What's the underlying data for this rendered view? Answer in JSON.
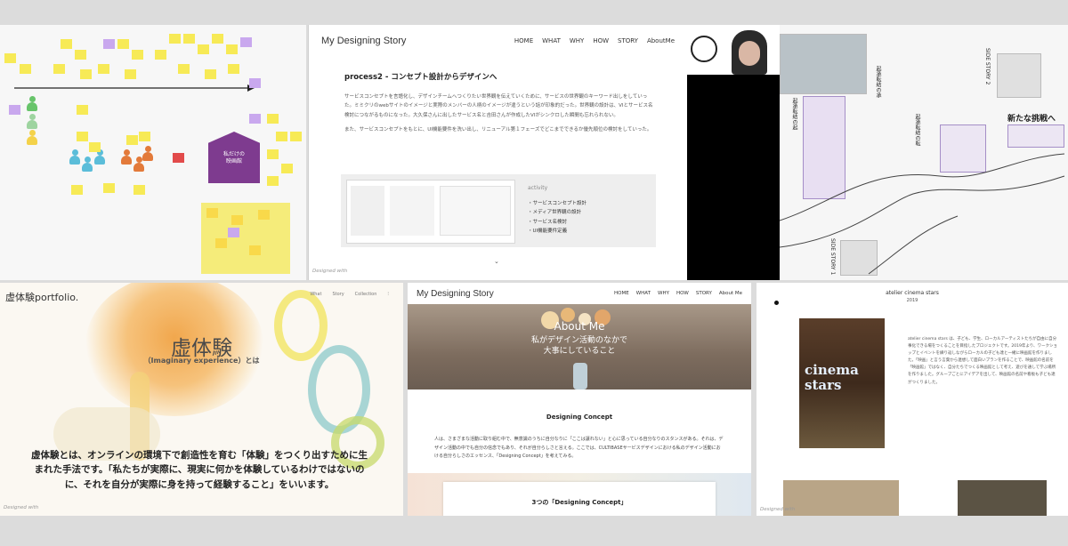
{
  "panel1": {
    "house_label_line1": "私だけの",
    "house_label_line2": "映画館"
  },
  "panel2": {
    "site_title": "My Designing Story",
    "nav": [
      "HOME",
      "WHAT",
      "WHY",
      "HOW",
      "STORY",
      "AboutMe"
    ],
    "section_title": "process2 - コンセプト設計からデザインへ",
    "para1": "サービスコンセプトを言語化し、デザインチームへつくりたい世界観を伝えていくために、サービスの世界観のキーワード出しをしていった。ミミクリのwebサイトのイメージと実際のメンバーの人柄のイメージが違うという話が印象的だった。世界観の設計は、VIとサービス名検討につながるものになった。大久保さんに出したサービス名と吉田さんが作成したVIがシンクロした瞬間も忘れられない。",
    "para2": "また、サービスコンセプトをもとに、UI機能要件を洗い出し、リニューアル第１フェーズでどこまでできるか優先順位の検討をしていった。",
    "activity_label": "activity",
    "activities": [
      "・サービスコンセプト設計",
      "・メディア世界観の設計",
      "・サービス名検討",
      "・UI機能要件定義"
    ],
    "footer": "Designed with"
  },
  "panel4": {
    "side_story_2": "SIDE STORY 2",
    "side_story_1": "SIDE STORY 1",
    "ki": "起承転結の起",
    "sho": "起承転結の承",
    "ten": "起承転結の転",
    "new_challenge": "新たな挑戦へ"
  },
  "panel5": {
    "logo": "虚体験portfolio.",
    "nav": [
      "What",
      "Story",
      "Collection"
    ],
    "heading": "虚体験",
    "subheading": "（Imaginary experience）とは",
    "body": "虚体験とは、オンラインの環境下で創造性を育む「体験」をつくり出すために生まれた手法です。「私たちが実際に、現実に何かを体験しているわけではないのに、それを自分が実際に身を持って経験すること」をいいます。",
    "footer": "Designed with"
  },
  "panel6": {
    "site_title": "My Designing Story",
    "nav": [
      "HOME",
      "WHAT",
      "WHY",
      "HOW",
      "STORY",
      "About Me"
    ],
    "hero_title": "About Me",
    "hero_sub1": "私がデザイン活動のなかで",
    "hero_sub2": "大事にしていること",
    "section_title": "Designing Concept",
    "body": "人は、さまざまな活動に取り組む中で、無意識のうちに自分なりに「ここは譲れない」と心に思っている自分なりのスタンスがある。それは、デザイン活動の中でも自分の信念でもあり、それが自分らしさと言える。ここでは、CULTIBASEサービスデザインにおける私のデザイン活動における自分らしさのエッセンス、「Designing Concept」を考えてみる。",
    "card_title": "3つの「Designing Concept」"
  },
  "panel7": {
    "title": "atelier cinema stars",
    "year": "2019",
    "poster_title_1": "cinema",
    "poster_title_2": "stars",
    "body": "atelier cinema stars は、子ども、学生、ローカルアーティストたちが自由に自分事化できる場をつくることを目指したプロジェクトです。2019年より、ワークショップとイベントを繰り返しながらローカルの子ども達と一緒に映画館を作りました。「映画」と言う言葉から連想して面白いプランを作ることで、映画館の名前を「映画館」ではなく、自分たちでつくる映画館として考え、遊びを通して学ぶ場所を作りました。グループごとにアイデアを出して、映画館の名前や看板も子ども達がつくりました。",
    "footer": "Designed with"
  }
}
